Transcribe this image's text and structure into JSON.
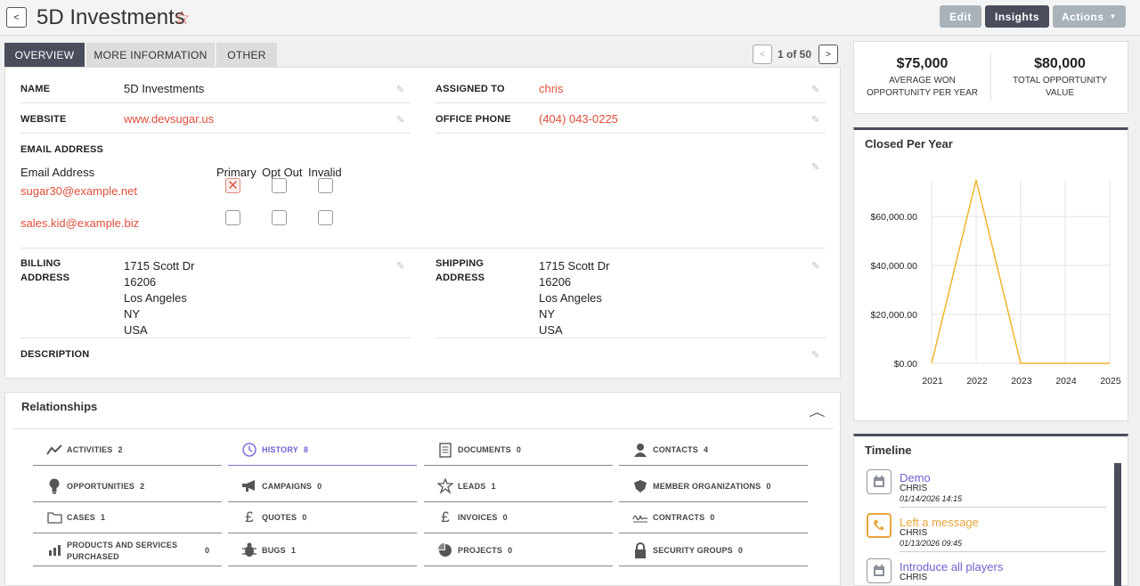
{
  "header": {
    "back_label": "<",
    "title": "5D Investments",
    "star_icon": "star-outline-icon",
    "edit_label": "Edit",
    "insights_label": "Insights",
    "actions_label": "Actions"
  },
  "tabs": [
    {
      "label": "OVERVIEW",
      "active": true
    },
    {
      "label": "MORE INFORMATION",
      "active": false
    },
    {
      "label": "OTHER",
      "active": false
    }
  ],
  "pager": {
    "prev": "<",
    "text": "1 of 50",
    "next": ">"
  },
  "fields": {
    "name_label": "NAME",
    "name": "5D Investments",
    "assigned_label": "ASSIGNED TO",
    "assigned": "chris",
    "website_label": "WEBSITE",
    "website": "www.devsugar.us",
    "phone_label": "OFFICE PHONE",
    "phone": "(404) 043-0225",
    "email_label": "EMAIL ADDRESS",
    "email_col": "Email Address",
    "primary_col": "Primary",
    "optout_col": "Opt Out",
    "invalid_col": "Invalid",
    "emails": [
      "sugar30@example.net",
      "sales.kid@example.biz"
    ],
    "billing_label_1": "BILLING",
    "billing_label_2": "ADDRESS",
    "billing": [
      "1715 Scott Dr",
      "16206",
      "Los Angeles",
      "NY",
      "USA"
    ],
    "shipping_label_1": "SHIPPING",
    "shipping_label_2": "ADDRESS",
    "shipping": [
      "1715 Scott Dr",
      "16206",
      "Los Angeles",
      "NY",
      "USA"
    ],
    "description_label": "DESCRIPTION"
  },
  "relationships": {
    "title": "Relationships",
    "items": [
      {
        "label": "ACTIVITIES",
        "count": "2"
      },
      {
        "label": "HISTORY",
        "count": "8"
      },
      {
        "label": "DOCUMENTS",
        "count": "0"
      },
      {
        "label": "CONTACTS",
        "count": "4"
      },
      {
        "label": "OPPORTUNITIES",
        "count": "2"
      },
      {
        "label": "CAMPAIGNS",
        "count": "0"
      },
      {
        "label": "LEADS",
        "count": "1"
      },
      {
        "label": "MEMBER ORGANIZATIONS",
        "count": "0"
      },
      {
        "label": "CASES",
        "count": "1"
      },
      {
        "label": "QUOTES",
        "count": "0"
      },
      {
        "label": "INVOICES",
        "count": "0"
      },
      {
        "label": "CONTRACTS",
        "count": "0"
      },
      {
        "label_1": "PRODUCTS AND SERVICES",
        "label_2": "PURCHASED",
        "count": "0"
      },
      {
        "label": "BUGS",
        "count": "1"
      },
      {
        "label": "PROJECTS",
        "count": "0"
      },
      {
        "label": "SECURITY GROUPS",
        "count": "0"
      }
    ]
  },
  "stats": {
    "avg_value": "$75,000",
    "avg_label_1": "AVERAGE WON",
    "avg_label_2": "OPPORTUNITY PER YEAR",
    "total_value": "$80,000",
    "total_label_1": "TOTAL OPPORTUNITY",
    "total_label_2": "VALUE"
  },
  "chart_title": "Closed Per Year",
  "chart_data": {
    "type": "line",
    "title": "Closed Per Year",
    "x": [
      "2021",
      "2022",
      "2023",
      "2024",
      "2025"
    ],
    "series": [
      {
        "values": [
          0,
          75000,
          0,
          0,
          0
        ]
      }
    ],
    "ylim": [
      0,
      75000
    ],
    "yticks": [
      0,
      20000,
      40000,
      60000
    ],
    "ytick_labels": [
      "$0.00",
      "$20,000.00",
      "$40,000.00",
      "$60,000.00"
    ],
    "grid": true,
    "line_color": "#f2b52b"
  },
  "timeline": {
    "title": "Timeline",
    "items": [
      {
        "title": "Demo",
        "user": "CHRIS",
        "date": "01/14/2026 14:15",
        "color": "#6c63d6",
        "icon": "calendar-icon"
      },
      {
        "title": "Left a message",
        "user": "CHRIS",
        "date": "01/13/2026 09:45",
        "color": "#e8a53c",
        "icon": "phone-icon"
      },
      {
        "title": "Introduce all players",
        "user": "CHRIS",
        "date": "",
        "color": "#6c63d6",
        "icon": "calendar-icon"
      }
    ]
  }
}
